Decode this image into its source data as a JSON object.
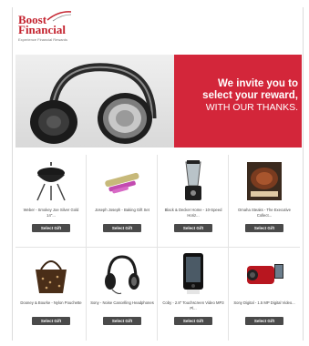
{
  "logo": {
    "line1": "Boost",
    "line2": "Financial",
    "tagline": "Experience Financial Rewards"
  },
  "banner": {
    "line1": "We invite you to",
    "line2": "select your reward,",
    "line3": "WITH OUR THANKS."
  },
  "products": [
    {
      "name": "Weber - Smokey Joe Silver Gold 14\"...",
      "button": "Select Gift",
      "icon": "grill-icon"
    },
    {
      "name": "Joseph Joseph - Baking Gift Set",
      "button": "Select Gift",
      "icon": "rolling-pin-icon"
    },
    {
      "name": "Black & Decker Home - 10-Speed Horiz...",
      "button": "Select Gift",
      "icon": "blender-icon"
    },
    {
      "name": "Omaha Steaks - The Executive Collect...",
      "button": "Select Gift",
      "icon": "steak-icon"
    },
    {
      "name": "Dooney & Bourke - Nylon Pouchette",
      "button": "Select Gift",
      "icon": "handbag-icon"
    },
    {
      "name": "Sony - Noise Cancelling Headphones",
      "button": "Select Gift",
      "icon": "headphones-icon"
    },
    {
      "name": "Coby - 2.8\" Touchscreen Video MP3 Pl...",
      "button": "Select Gift",
      "icon": "mp3-player-icon"
    },
    {
      "name": "Sony Digital - 1.5 MP Digital Video...",
      "button": "Select Gift",
      "icon": "camcorder-icon"
    }
  ],
  "colors": {
    "brand_red": "#c4232f",
    "banner_red": "#d3263a",
    "button_gray": "#4a4a4a"
  }
}
